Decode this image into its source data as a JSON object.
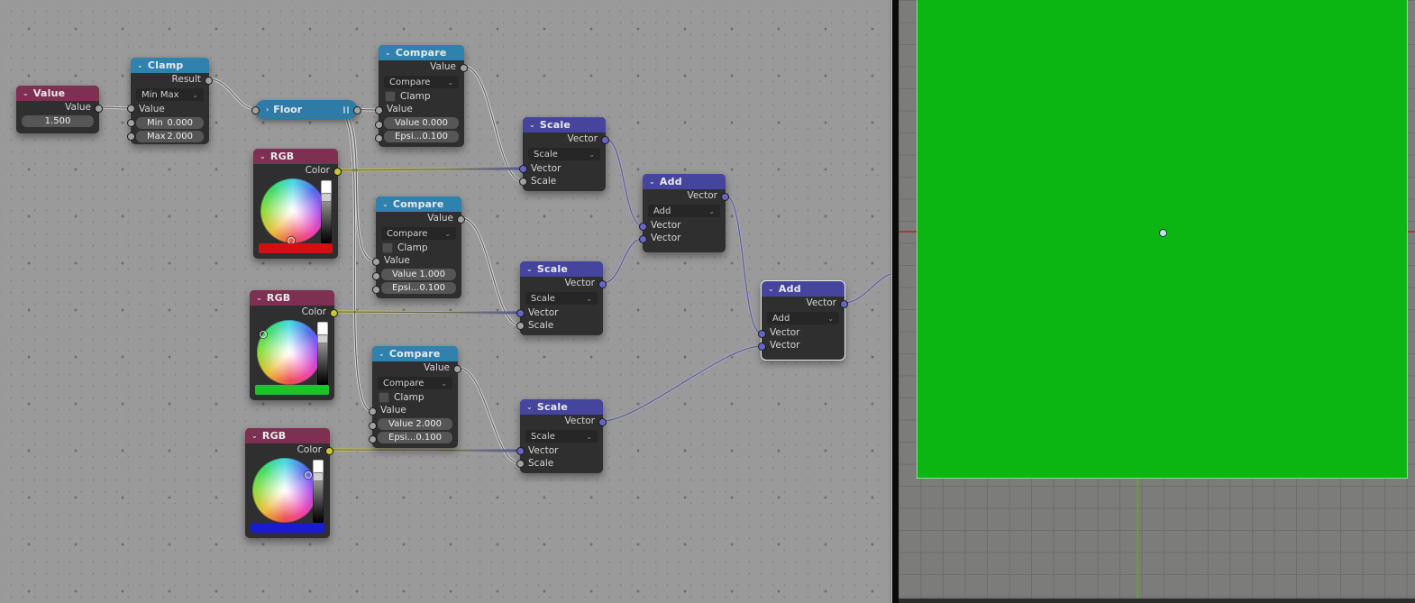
{
  "icons": {
    "chevron_down": "⌄",
    "chevron_right": "›",
    "dropdown_arrow": "⌄"
  },
  "node_editor": {
    "background_color": "#9a9a9a",
    "nodes": {
      "value": {
        "title": "Value",
        "header_color": "#7d3052",
        "output_label": "Value",
        "value_field": "1.500"
      },
      "clamp": {
        "title": "Clamp",
        "header_color": "#2e82ad",
        "output_label": "Result",
        "operation": "Min Max",
        "input_label": "Value",
        "min_label": "Min",
        "min_value": "0.000",
        "max_label": "Max",
        "max_value": "2.000"
      },
      "floor": {
        "title": "Floor",
        "header_color": "#2e7ca6"
      },
      "compare_top": {
        "title": "Compare",
        "header_color": "#2e82ad",
        "output_label": "Value",
        "operation": "Compare",
        "clamp_label": "Clamp",
        "input_label": "Value",
        "value_label": "Value",
        "value": "0.000",
        "epsilon_label": "Epsi...",
        "epsilon_value": "0.100"
      },
      "compare_mid": {
        "title": "Compare",
        "header_color": "#2e82ad",
        "output_label": "Value",
        "operation": "Compare",
        "clamp_label": "Clamp",
        "input_label": "Value",
        "value_label": "Value",
        "value": "1.000",
        "epsilon_label": "Epsi...",
        "epsilon_value": "0.100"
      },
      "compare_bottom": {
        "title": "Compare",
        "header_color": "#2e82ad",
        "output_label": "Value",
        "operation": "Compare",
        "clamp_label": "Clamp",
        "input_label": "Value",
        "value_label": "Value",
        "value": "2.000",
        "epsilon_label": "Epsi...",
        "epsilon_value": "0.100"
      },
      "rgb_red": {
        "title": "RGB",
        "header_color": "#7d3052",
        "output_label": "Color",
        "color": "#d01113"
      },
      "rgb_green": {
        "title": "RGB",
        "header_color": "#7d3052",
        "output_label": "Color",
        "color": "#1cc32b"
      },
      "rgb_blue": {
        "title": "RGB",
        "header_color": "#7d3052",
        "output_label": "Color",
        "color": "#1a1bd0"
      },
      "scale_top": {
        "title": "Scale",
        "header_color": "#45459e",
        "output_label": "Vector",
        "operation": "Scale",
        "input1_label": "Vector",
        "input2_label": "Scale"
      },
      "scale_mid": {
        "title": "Scale",
        "header_color": "#45459e",
        "output_label": "Vector",
        "operation": "Scale",
        "input1_label": "Vector",
        "input2_label": "Scale"
      },
      "scale_bottom": {
        "title": "Scale",
        "header_color": "#45459e",
        "output_label": "Vector",
        "operation": "Scale",
        "input1_label": "Vector",
        "input2_label": "Scale"
      },
      "add_left": {
        "title": "Add",
        "header_color": "#45459e",
        "output_label": "Vector",
        "operation": "Add",
        "input1_label": "Vector",
        "input2_label": "Vector"
      },
      "add_right": {
        "title": "Add",
        "header_color": "#45459e",
        "selected": true,
        "output_label": "Vector",
        "operation": "Add",
        "input1_label": "Vector",
        "input2_label": "Vector"
      }
    },
    "socket_colors": {
      "float": "#a1a1a1",
      "color": "#c8c832",
      "vector": "#6766c4"
    },
    "wire_colors": {
      "float": "#dadada",
      "vector": "#a4a4dc",
      "color_to_vector_start": "#d0d032",
      "color_to_vector_end": "#4d4dc0"
    }
  },
  "viewport_3d": {
    "background_color": "#7c7c7a",
    "grid_line_color": "#6e6e6c",
    "plane_color": "#0cb612",
    "plane_outline_color": "#8be18d",
    "x_axis_color": "#a33a3a",
    "y_axis_color": "#6f9b33",
    "origin_dot_color": "#b9e6de"
  }
}
